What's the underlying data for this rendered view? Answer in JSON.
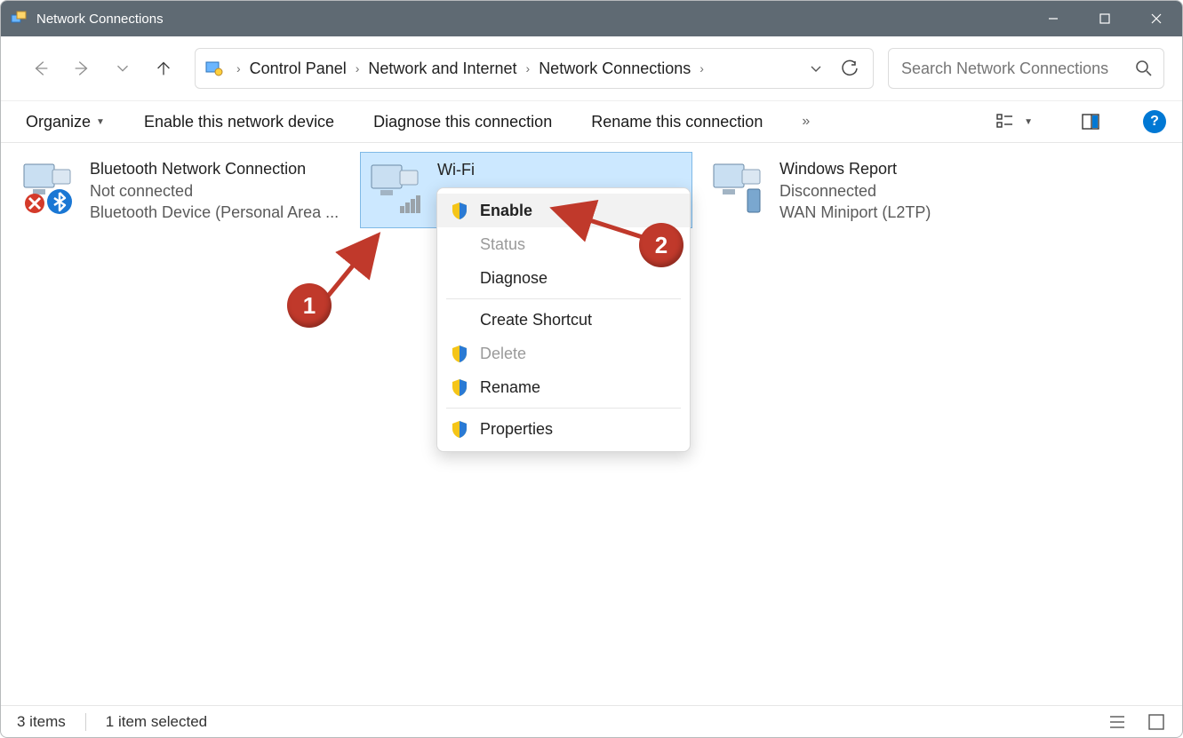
{
  "title": "Network Connections",
  "breadcrumbs": [
    "Control Panel",
    "Network and Internet",
    "Network Connections"
  ],
  "search": {
    "placeholder": "Search Network Connections"
  },
  "toolbar": {
    "organize": "Organize",
    "enable_device": "Enable this network device",
    "diagnose": "Diagnose this connection",
    "rename": "Rename this connection",
    "overflow": "»"
  },
  "connections": [
    {
      "name": "Bluetooth Network Connection",
      "status": "Not connected",
      "device": "Bluetooth Device (Personal Area ..."
    },
    {
      "name": "Wi-Fi",
      "status": "",
      "device": ""
    },
    {
      "name": "Windows Report",
      "status": "Disconnected",
      "device": "WAN Miniport (L2TP)"
    }
  ],
  "context_menu": {
    "enable": "Enable",
    "status": "Status",
    "diagnose": "Diagnose",
    "create_shortcut": "Create Shortcut",
    "delete": "Delete",
    "rename": "Rename",
    "properties": "Properties"
  },
  "annotations": {
    "one": "1",
    "two": "2"
  },
  "statusbar": {
    "items": "3 items",
    "selected": "1 item selected"
  }
}
